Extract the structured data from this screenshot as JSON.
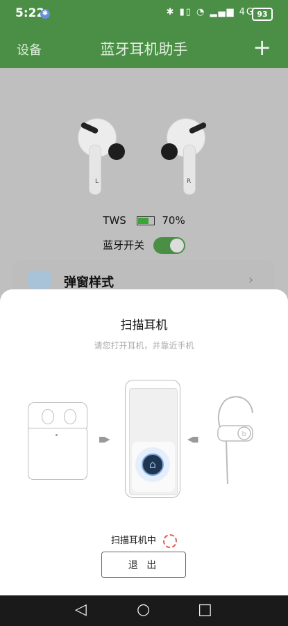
{
  "status_bar": {
    "time": "5:22",
    "bt_badge": "✱",
    "icons": "✱ ▮▯ ◔ ▂▄▆ 4G",
    "battery": "93"
  },
  "header": {
    "left_label": "设备",
    "title": "蓝牙耳机助手",
    "add_icon": "+"
  },
  "earbuds": {
    "left_letter": "L",
    "right_letter": "R"
  },
  "device_status": {
    "name": "TWS",
    "battery_text": "70%",
    "battery_level": 0.7,
    "bt_switch_label": "蓝牙开关",
    "bt_switch_on": true
  },
  "settings_item": {
    "label": "弹窗样式",
    "chevron": "›"
  },
  "sheet": {
    "title": "扫描耳机",
    "subtitle": "请您打开耳机，并靠近手机",
    "arrow_left": "▮▮▶",
    "arrow_right": "◀▮▮",
    "scan_glyph": "⌂",
    "scanning_text": "扫描耳机中",
    "exit_button": "退 出"
  },
  "navbar": {
    "back": "◁",
    "home": "○",
    "recents": "□"
  },
  "colors": {
    "accent": "#4a8f45",
    "battery_fill": "#3aa538",
    "spinner": "#e75c4f"
  }
}
